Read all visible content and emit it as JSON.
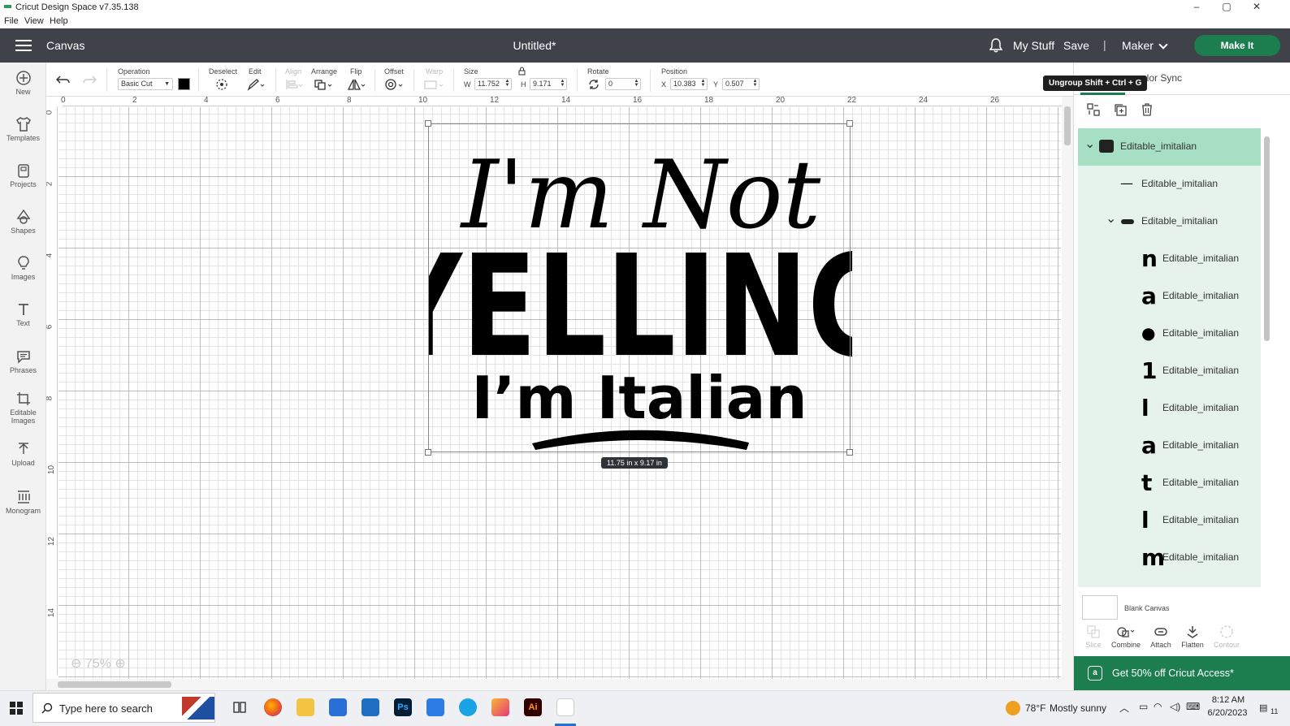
{
  "window": {
    "title": "Cricut Design Space  v7.35.138",
    "controls": {
      "minimize": "–",
      "maximize": "▢",
      "close": "✕"
    }
  },
  "menubar": {
    "items": [
      "File",
      "View",
      "Help"
    ]
  },
  "header": {
    "canvas_label": "Canvas",
    "doc_title": "Untitled*",
    "my_stuff": "My Stuff",
    "save": "Save",
    "separator": "|",
    "machine": "Maker",
    "make_it": "Make It"
  },
  "sidebar": {
    "items": [
      {
        "label": "New",
        "icon": "plus-circle-icon"
      },
      {
        "label": "Templates",
        "icon": "shirt-icon"
      },
      {
        "label": "Projects",
        "icon": "projects-icon"
      },
      {
        "label": "Shapes",
        "icon": "shapes-icon"
      },
      {
        "label": "Images",
        "icon": "lightbulb-icon"
      },
      {
        "label": "Text",
        "icon": "text-icon"
      },
      {
        "label": "Phrases",
        "icon": "speech-bubble-icon"
      },
      {
        "label": "Editable",
        "label2": "Images",
        "icon": "editable-images-icon"
      },
      {
        "label": "Upload",
        "icon": "upload-icon"
      },
      {
        "label": "Monogram",
        "icon": "monogram-icon"
      }
    ]
  },
  "toolbar": {
    "operation_label": "Operation",
    "operation_value": "Basic Cut",
    "operation_color": "#000000",
    "deselect": "Deselect",
    "edit": "Edit",
    "align": "Align",
    "arrange": "Arrange",
    "flip": "Flip",
    "offset": "Offset",
    "warp": "Warp",
    "size_label": "Size",
    "w_label": "W",
    "w_value": "11.752",
    "h_label": "H",
    "h_value": "9.171",
    "rotate_label": "Rotate",
    "rotate_value": "0",
    "position_label": "Position",
    "x_label": "X",
    "x_value": "10.383",
    "y_label": "Y",
    "y_value": "0.507"
  },
  "canvas": {
    "h_ruler": [
      "0",
      "2",
      "4",
      "6",
      "8",
      "10",
      "12",
      "14",
      "16",
      "18",
      "20",
      "22",
      "24",
      "26"
    ],
    "v_ruler": [
      "0",
      "2",
      "4",
      "6",
      "8",
      "10",
      "12",
      "14"
    ],
    "zoom": "75%",
    "design": {
      "line1": "I'm Not",
      "line2": "YELLING",
      "line3": "I’m Italian"
    },
    "size_tag": "11.75  in x 9.17  in"
  },
  "right_panel": {
    "tab_color_sync": "olor Sync",
    "tooltip": "Ungroup Shift + Ctrl + G",
    "layers": [
      {
        "name": "Editable_imitalian",
        "glyph": "",
        "level": 0
      },
      {
        "name": "Editable_imitalian",
        "glyph": "—",
        "level": 1
      },
      {
        "name": "Editable_imitalian",
        "glyph": "",
        "level": 1
      },
      {
        "name": "Editable_imitalian",
        "glyph": "n",
        "level": 2
      },
      {
        "name": "Editable_imitalian",
        "glyph": "a",
        "level": 2
      },
      {
        "name": "Editable_imitalian",
        "glyph": "●",
        "level": 2
      },
      {
        "name": "Editable_imitalian",
        "glyph": "1",
        "level": 2
      },
      {
        "name": "Editable_imitalian",
        "glyph": "l",
        "level": 2
      },
      {
        "name": "Editable_imitalian",
        "glyph": "a",
        "level": 2
      },
      {
        "name": "Editable_imitalian",
        "glyph": "t",
        "level": 2
      },
      {
        "name": "Editable_imitalian",
        "glyph": "l",
        "level": 2
      },
      {
        "name": "Editable_imitalian",
        "glyph": "m",
        "level": 2
      },
      {
        "name": "Editable_imitalian",
        "glyph": "●",
        "level": 2
      }
    ],
    "blank_canvas": "Blank Canvas",
    "bottom_actions": [
      "Slice",
      "Combine",
      "Attach",
      "Flatten",
      "Contour"
    ],
    "promo": "Get 50% off Cricut Access*"
  },
  "taskbar": {
    "search_placeholder": "Type here to search",
    "weather_temp": "78°F",
    "weather_desc": "Mostly sunny",
    "time": "8:12 AM",
    "date": "6/20/2023",
    "notif_count": "11"
  },
  "colors": {
    "header_bg": "#3f4349",
    "accent_green": "#1c7e4f",
    "selected_layer": "#a6dfc3",
    "layers_bg": "#e6f3ed"
  }
}
